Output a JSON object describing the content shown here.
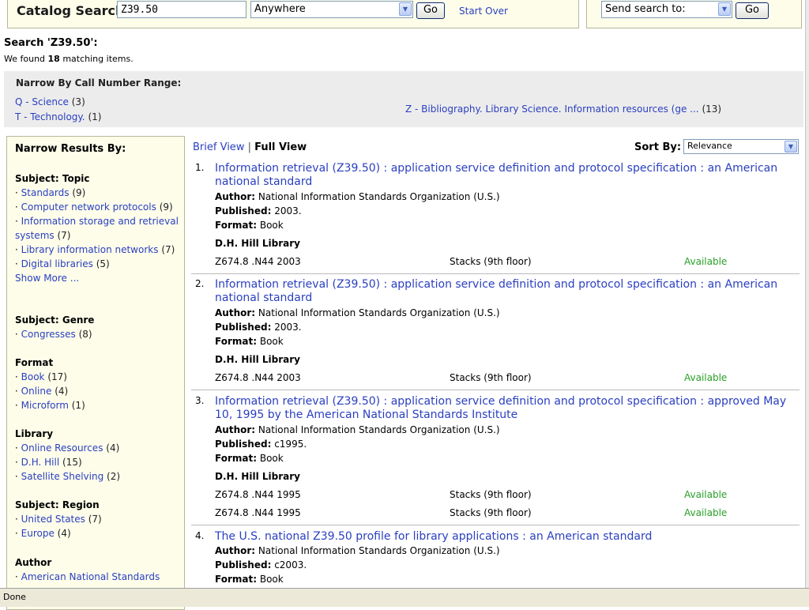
{
  "search": {
    "label": "Catalog Search:",
    "query": "Z39.50",
    "scope": "Anywhere",
    "go_label": "Go",
    "start_over": "Start Over",
    "send_to": "Send search to:",
    "send_go": "Go"
  },
  "heading": {
    "title": "Search 'Z39.50':",
    "found_prefix": "We found ",
    "count": "18",
    "found_suffix": " matching items."
  },
  "call_range": {
    "title": "Narrow By Call Number Range:",
    "items": [
      {
        "label": "Q - Science",
        "count": "(3)"
      },
      {
        "label": "T - Technology.",
        "count": "(1)"
      },
      {
        "label": "Z - Bibliography. Library Science. Information resources (ge ...",
        "count": "(13)"
      }
    ]
  },
  "facets": {
    "title": "Narrow Results By:",
    "groups": [
      {
        "heading": "Subject: Topic",
        "items": [
          {
            "label": "Standards",
            "count": "(9)"
          },
          {
            "label": "Computer network protocols",
            "count": "(9)"
          },
          {
            "label": "Information storage and retrieval systems",
            "count": "(7)"
          },
          {
            "label": "Library information networks",
            "count": "(7)"
          },
          {
            "label": "Digital libraries",
            "count": "(5)"
          }
        ],
        "show_more": "Show More ..."
      },
      {
        "heading": "Subject: Genre",
        "items": [
          {
            "label": "Congresses",
            "count": "(8)"
          }
        ]
      },
      {
        "heading": "Format",
        "items": [
          {
            "label": "Book",
            "count": "(17)"
          },
          {
            "label": "Online",
            "count": "(4)"
          },
          {
            "label": "Microform",
            "count": "(1)"
          }
        ]
      },
      {
        "heading": "Library",
        "items": [
          {
            "label": "Online Resources",
            "count": "(4)"
          },
          {
            "label": "D.H. Hill",
            "count": "(15)"
          },
          {
            "label": "Satellite Shelving",
            "count": "(2)"
          }
        ]
      },
      {
        "heading": "Subject: Region",
        "items": [
          {
            "label": "United States",
            "count": "(7)"
          },
          {
            "label": "Europe",
            "count": "(4)"
          }
        ]
      },
      {
        "heading": "Author",
        "items": [
          {
            "label": "American National Standards",
            "count": ""
          }
        ]
      }
    ]
  },
  "view": {
    "brief": "Brief View",
    "separator": "|",
    "full": "Full View",
    "sort_label": "Sort By:",
    "sort_value": "Relevance"
  },
  "labels": {
    "author": "Author:",
    "published": "Published:",
    "format": "Format:"
  },
  "results": [
    {
      "num": "1.",
      "title": "Information retrieval (Z39.50) : application service definition and protocol specification : an American national standard",
      "author": "National Information Standards Organization (U.S.)",
      "published": "2003.",
      "format": "Book",
      "library": "D.H. Hill Library",
      "holdings": [
        {
          "call": "Z674.8 .N44 2003",
          "location": "Stacks (9th floor)",
          "status": "Available"
        }
      ]
    },
    {
      "num": "2.",
      "title": "Information retrieval (Z39.50) : application service definition and protocol specification : an American national standard",
      "author": "National Information Standards Organization (U.S.)",
      "published": "2003.",
      "format": "Book",
      "library": "D.H. Hill Library",
      "holdings": [
        {
          "call": "Z674.8 .N44 2003",
          "location": "Stacks (9th floor)",
          "status": "Available"
        }
      ]
    },
    {
      "num": "3.",
      "title": "Information retrieval (Z39.50) : application service definition and protocol specification : approved May 10, 1995 by the American National Standards Institute",
      "author": "National Information Standards Organization (U.S.)",
      "published": "c1995.",
      "format": "Book",
      "library": "D.H. Hill Library",
      "holdings": [
        {
          "call": "Z674.8 .N44 1995",
          "location": "Stacks (9th floor)",
          "status": "Available"
        },
        {
          "call": "Z674.8 .N44 1995",
          "location": "Stacks (9th floor)",
          "status": "Available"
        }
      ]
    },
    {
      "num": "4.",
      "title": "The U.S. national Z39.50 profile for library applications : an American standard",
      "author": "National Information Standards Organization (U.S.)",
      "published": "c2003.",
      "format": "Book"
    }
  ],
  "statusbar": {
    "text": "Done"
  }
}
